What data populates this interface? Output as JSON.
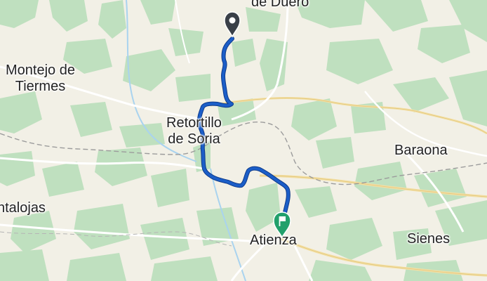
{
  "map": {
    "colors": {
      "background": "#f2f0e6",
      "vegetation": "#bfe0bf",
      "road": "#ffffff",
      "road_regional": "#f3dfa4",
      "border": "#9c9c9c",
      "river": "#a9d3ef",
      "route": "#1b5ec8",
      "route_outline": "#0e3a8a",
      "start_marker": "#3a4048",
      "end_marker": "#22a06b"
    },
    "places": [
      {
        "id": "montejo",
        "lines": [
          "Montejo de",
          "Tiermes"
        ]
      },
      {
        "id": "retortillo",
        "lines": [
          "Retortillo",
          "de Soria"
        ]
      },
      {
        "id": "baraona",
        "lines": [
          "Baraona"
        ]
      },
      {
        "id": "atienza",
        "lines": [
          "Atienza"
        ]
      },
      {
        "id": "sienes",
        "lines": [
          "Sienes"
        ]
      },
      {
        "id": "duero",
        "lines": [
          "de Duero"
        ]
      },
      {
        "id": "ntalojas",
        "lines": [
          "ntalojas"
        ]
      }
    ],
    "markers": {
      "start_icon": "location-pin-icon",
      "end_icon": "flag-pin-icon"
    }
  }
}
